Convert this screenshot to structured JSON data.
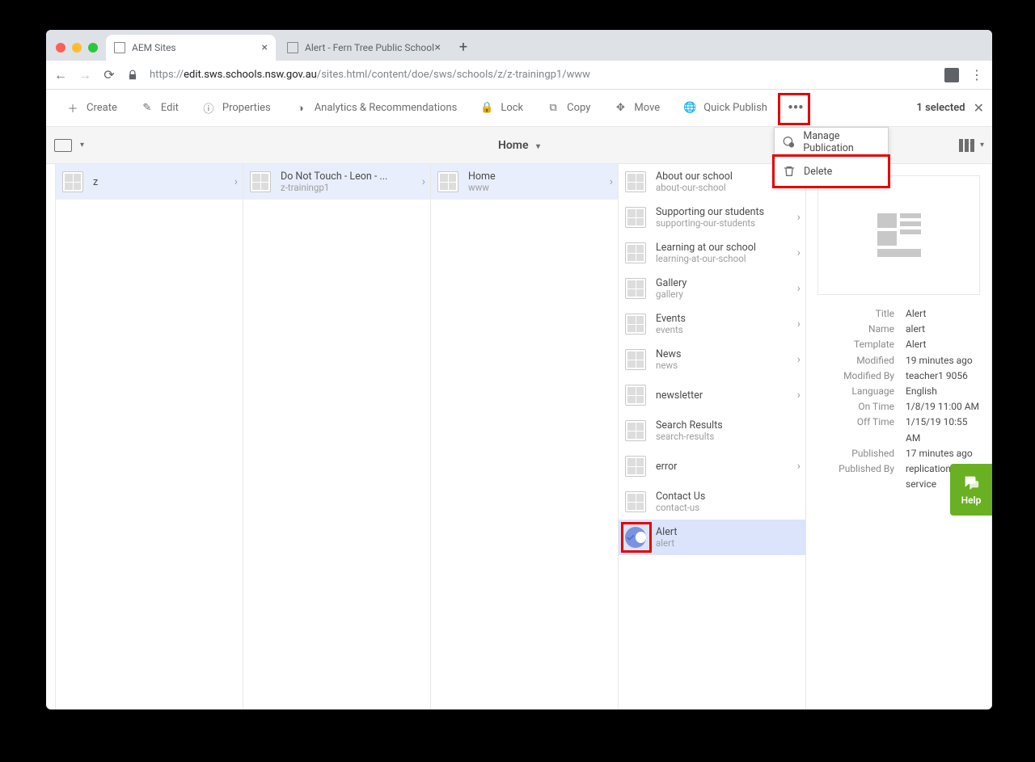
{
  "tabs": [
    {
      "title": "AEM Sites"
    },
    {
      "title": "Alert - Fern Tree Public School"
    }
  ],
  "url_secure": "https://",
  "url_host": "edit.sws.schools.nsw.gov.au",
  "url_path": "/sites.html/content/doe/sws/schools/z/z-trainingp1/www",
  "actions": {
    "create": "Create",
    "edit": "Edit",
    "properties": "Properties",
    "analytics": "Analytics & Recommendations",
    "lock": "Lock",
    "copy": "Copy",
    "move": "Move",
    "quickpublish": "Quick Publish"
  },
  "selected_label": "1 selected",
  "breadcrumb": "Home",
  "columns": [
    {
      "rows": [
        {
          "t1": "z",
          "t2": ""
        }
      ]
    },
    {
      "rows": [
        {
          "t1": "Do Not Touch - Leon - ...",
          "t2": "z-trainingp1"
        }
      ]
    },
    {
      "rows": [
        {
          "t1": "Home",
          "t2": "www"
        }
      ]
    },
    {
      "rows": [
        {
          "t1": "About our school",
          "t2": "about-our-school",
          "chev": false
        },
        {
          "t1": "Supporting our students",
          "t2": "supporting-our-students",
          "chev": true
        },
        {
          "t1": "Learning at our school",
          "t2": "learning-at-our-school",
          "chev": true
        },
        {
          "t1": "Gallery",
          "t2": "gallery",
          "chev": true
        },
        {
          "t1": "Events",
          "t2": "events",
          "chev": true
        },
        {
          "t1": "News",
          "t2": "news",
          "chev": true
        },
        {
          "t1": "newsletter",
          "t2": "",
          "chev": true
        },
        {
          "t1": "Search Results",
          "t2": "search-results",
          "chev": false
        },
        {
          "t1": "error",
          "t2": "",
          "chev": true
        },
        {
          "t1": "Contact Us",
          "t2": "contact-us",
          "chev": false
        },
        {
          "t1": "Alert",
          "t2": "alert",
          "chev": false,
          "selected": true
        }
      ]
    }
  ],
  "detail": {
    "Title": "Alert",
    "Name": "alert",
    "Template": "Alert",
    "Modified": "19 minutes ago",
    "Modified By": "teacher1 9056",
    "Language": "English",
    "On Time": "1/8/19 11:00 AM",
    "Off Time": "1/15/19 10:55 AM",
    "Published": "17 minutes ago",
    "Published By": "replication-service"
  },
  "detail_keys": [
    "Title",
    "Name",
    "Template",
    "Modified",
    "Modified By",
    "Language",
    "On Time",
    "Off Time",
    "Published",
    "Published By"
  ],
  "menu": {
    "manage": "Manage Publication",
    "delete": "Delete"
  },
  "help": "Help"
}
